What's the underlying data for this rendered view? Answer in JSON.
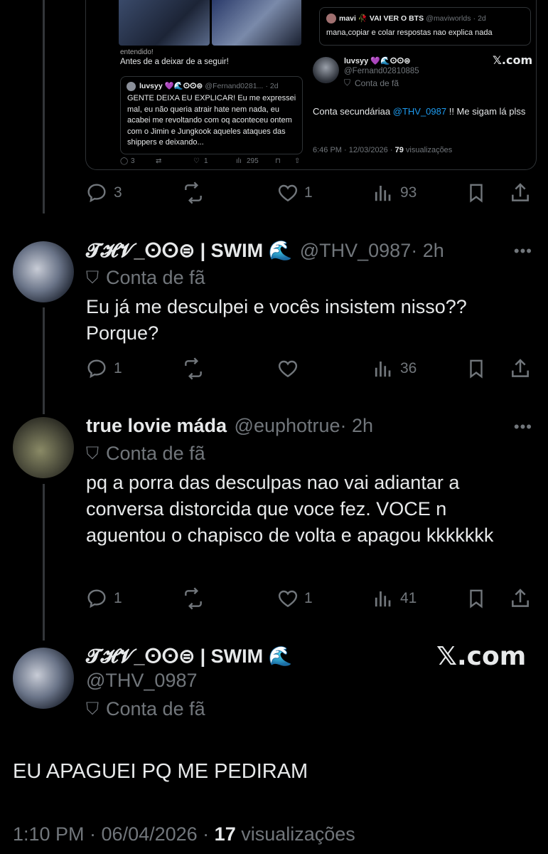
{
  "embed": {
    "left_tweet_tail": "entendido!",
    "left_tweet_line": "Antes de a deixar de a seguir!",
    "quoted_left": {
      "name": "luvsyy 💜🌊ⵙⵙ⊜",
      "handle": "@Fernand0281...",
      "time": "· 2d",
      "text": "GENTE DEIXA EU EXPLICAR! Eu me expressei mal, eu não queria atrair hate nem nada, eu acabei me revoltando com oq aconteceu ontem com o Jimin e Jungkook aqueles ataques das shippers e deixando..."
    },
    "left_actions": [
      "3",
      "",
      "1",
      "295",
      "",
      ""
    ],
    "quoted_right": {
      "name": "mavi 🥀 VAI VER O BTS",
      "handle": "@maviworlds",
      "time": "· 2d",
      "text": "mana,copiar e colar respostas nao explica nada"
    },
    "right_tweet": {
      "name": "luvsyy 💜🌊ⵙⵙ⊜",
      "handle": "@Fernand02810885",
      "badge": "Conta de fã",
      "text_before": "Conta secundáriaa ",
      "mention": "@THV_0987",
      "text_after": " !! Me sigam lá plss",
      "meta": "6:46 PM · 12/03/2026 · ",
      "views": "79",
      "views_label": " visualizações",
      "logo": "𝕏.com"
    }
  },
  "post1_actions": {
    "replies": "3",
    "retweets": "",
    "likes": "1",
    "views": "93"
  },
  "reply1": {
    "name": "𝓣𝓗𝓥_ⵙⵙ⊜ | SWIM 🌊",
    "handle": "@THV_0987",
    "time": "· 2h",
    "badge": "Conta de fã",
    "text": "Eu já me desculpei e vocês insistem nisso?? Porque?",
    "replies": "1",
    "retweets": "",
    "likes": "",
    "views": "36"
  },
  "reply2": {
    "name": "true lovie máda",
    "handle": "@euphotrue",
    "time": "· 2h",
    "badge": "Conta de fã",
    "text": "pq a porra das desculpas nao vai adiantar a conversa distorcida que voce fez. VOCE n aguentou o chapisco de volta e apagou kkkkkkk",
    "replies": "1",
    "retweets": "",
    "likes": "1",
    "views": "41"
  },
  "main": {
    "name": "𝓣𝓗𝓥_ⵙⵙ⊜ | SWIM 🌊",
    "handle": "@THV_0987",
    "badge": "Conta de fã",
    "logo": "𝕏.com",
    "text": "EU APAGUEI PQ ME PEDIRAM",
    "meta": "1:10 PM · 06/04/2026 · ",
    "views": "17",
    "views_label": " visualizações"
  },
  "more_label": "•••",
  "colors": {
    "background": "#000000",
    "text": "#e7e9ea",
    "secondary": "#71767b",
    "link": "#1d9bf0",
    "border": "#2f3336"
  }
}
